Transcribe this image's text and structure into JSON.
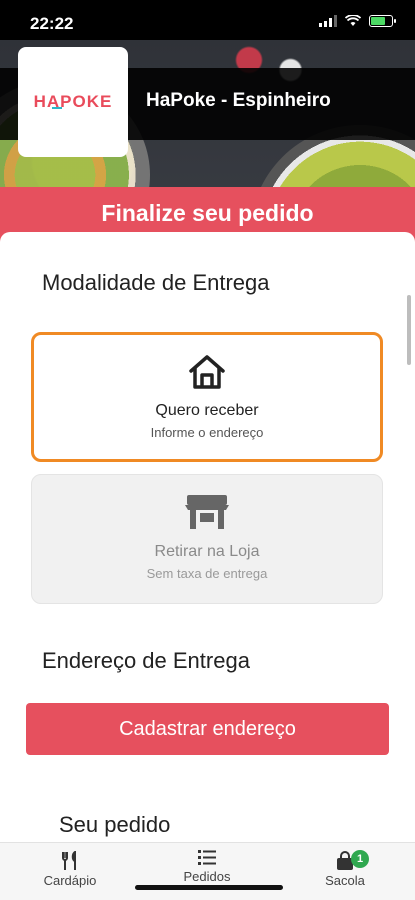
{
  "status": {
    "time": "22:22"
  },
  "store": {
    "name": "HaPoke - Espinheiro",
    "logo_text": "HAPOKE"
  },
  "banner": {
    "title": "Finalize seu pedido"
  },
  "delivery_mode": {
    "title": "Modalidade de Entrega",
    "options": [
      {
        "label": "Quero receber",
        "sub": "Informe o endereço",
        "icon": "house-icon",
        "selected": true
      },
      {
        "label": "Retirar na Loja",
        "sub": "Sem taxa de entrega",
        "icon": "store-icon",
        "selected": false
      }
    ]
  },
  "address": {
    "title": "Endereço de Entrega",
    "button_label": "Cadastrar endereço"
  },
  "order": {
    "title": "Seu pedido"
  },
  "tabs": [
    {
      "label": "Cardápio",
      "icon": "utensils-icon"
    },
    {
      "label": "Pedidos",
      "icon": "list-icon"
    },
    {
      "label": "Sacola",
      "icon": "bag-icon",
      "badge": "1"
    }
  ],
  "colors": {
    "accent": "#e6505e",
    "selected_border": "#f08a24",
    "badge": "#2fa84f"
  }
}
